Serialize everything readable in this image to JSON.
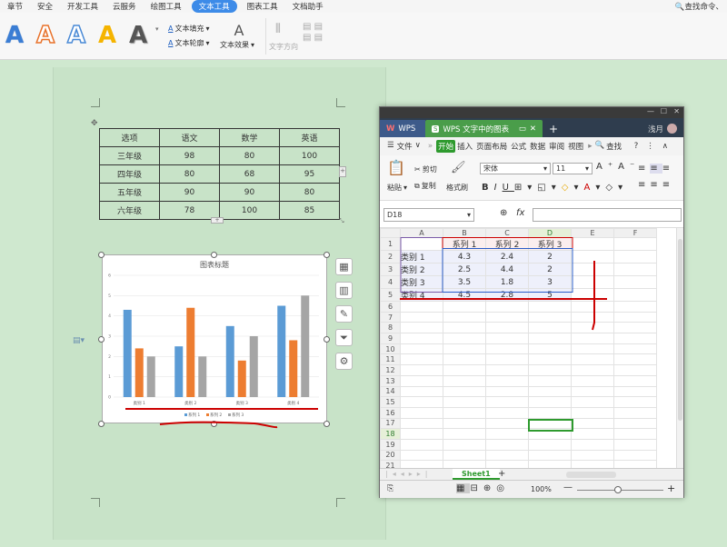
{
  "menubar": {
    "items": [
      "章节",
      "安全",
      "开发工具",
      "云服务",
      "绘图工具",
      "文本工具",
      "图表工具",
      "文档助手"
    ],
    "active_index": 5,
    "search_label": "查找命令、"
  },
  "ribbon": {
    "wordart_letter": "A",
    "text_fill": "文本填充",
    "text_outline": "文本轮廓",
    "text_effect": "文本效果",
    "text_direction": "文字方向"
  },
  "doc_table": {
    "headers": [
      "选项",
      "语文",
      "数学",
      "英语"
    ],
    "rows": [
      [
        "三年级",
        "98",
        "80",
        "100"
      ],
      [
        "四年级",
        "80",
        "68",
        "95"
      ],
      [
        "五年级",
        "90",
        "90",
        "80"
      ],
      [
        "六年级",
        "78",
        "100",
        "85"
      ]
    ]
  },
  "chart_data": {
    "type": "bar",
    "title": "图表标题",
    "categories": [
      "类别 1",
      "类别 2",
      "类别 3",
      "类别 4"
    ],
    "series": [
      {
        "name": "系列 1",
        "values": [
          4.3,
          2.5,
          3.5,
          4.5
        ],
        "color": "#5b9bd5"
      },
      {
        "name": "系列 2",
        "values": [
          2.4,
          4.4,
          1.8,
          2.8
        ],
        "color": "#ed7d31"
      },
      {
        "name": "系列 3",
        "values": [
          2,
          2,
          3,
          5
        ],
        "color": "#a5a5a5"
      }
    ],
    "ylim": [
      0,
      6
    ],
    "yticks": [
      "0",
      "1",
      "2",
      "3",
      "4",
      "5",
      "6"
    ],
    "legend_position": "bottom",
    "grid": true
  },
  "wps": {
    "tab_wps": "WPS",
    "tab_doc": "WPS 文字中的图表",
    "user": "浅月",
    "menu": [
      "文件",
      "开始",
      "插入",
      "页面布局",
      "公式",
      "数据",
      "审阅",
      "视图"
    ],
    "menu_active": "开始",
    "find": "查找",
    "cut": "剪切",
    "copy": "复制",
    "paste": "粘贴",
    "format_painter": "格式刷",
    "font": "宋体",
    "size": "11",
    "cell_ref": "D18",
    "fx": "fx",
    "columns": [
      "A",
      "B",
      "C",
      "D",
      "E",
      "F"
    ],
    "rows_count": 21,
    "sheet_data": [
      [
        "",
        "系列 1",
        "系列 2",
        "系列 3"
      ],
      [
        "类别 1",
        "4.3",
        "2.4",
        "2"
      ],
      [
        "类别 2",
        "2.5",
        "4.4",
        "2"
      ],
      [
        "类别 3",
        "3.5",
        "1.8",
        "3"
      ],
      [
        "类别 4",
        "4.5",
        "2.8",
        "5"
      ]
    ],
    "sheet_tab": "Sheet1",
    "zoom": "100%"
  }
}
